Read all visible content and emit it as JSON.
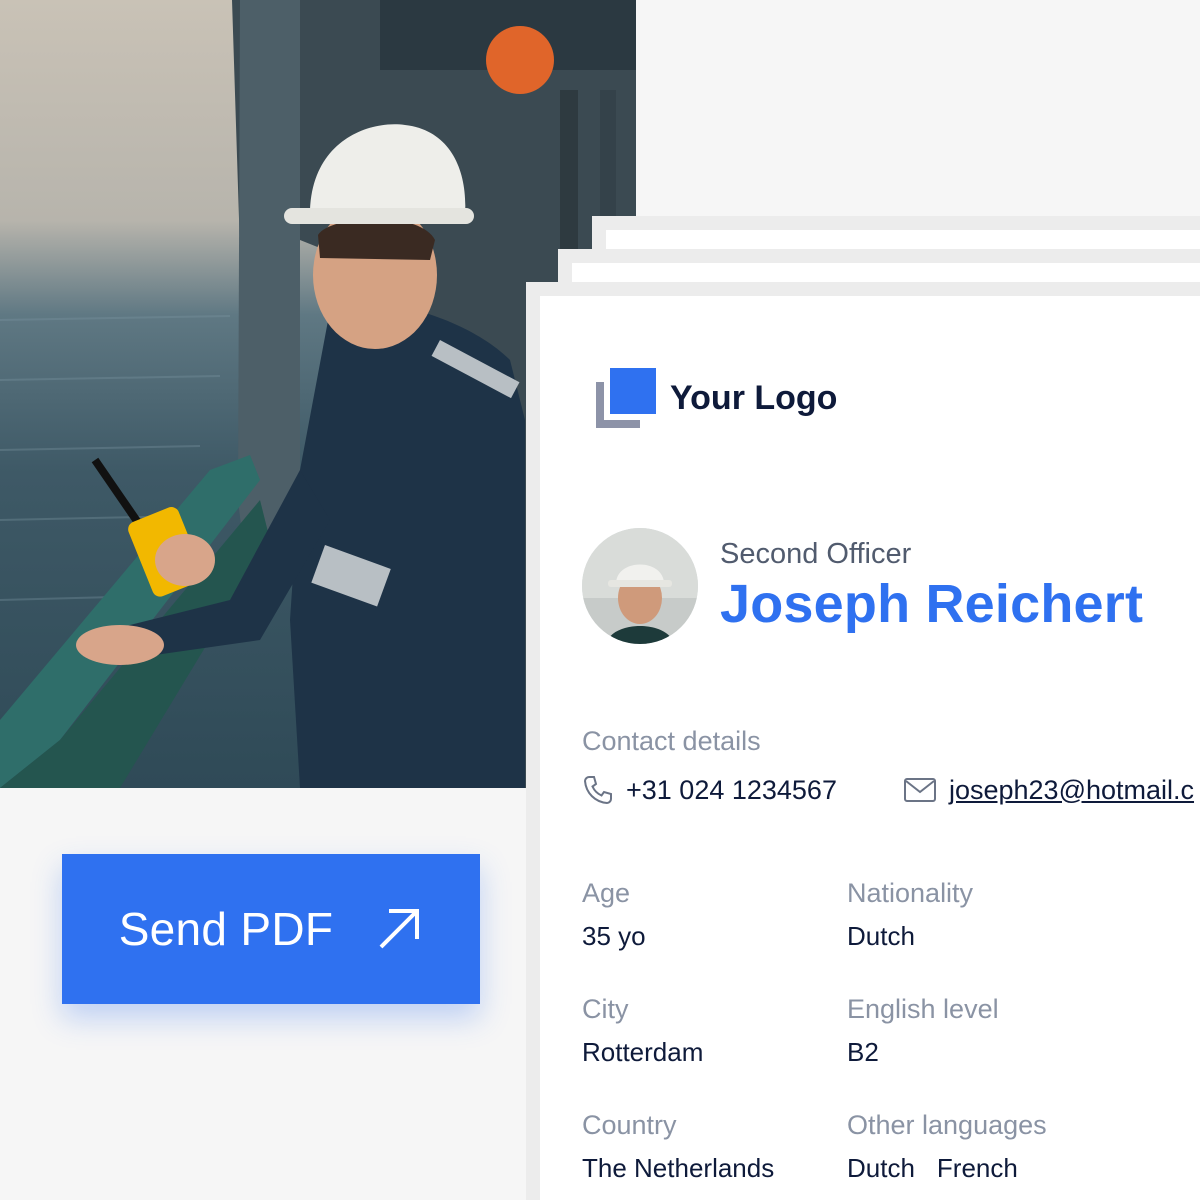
{
  "send_button": {
    "label": "Send PDF",
    "icon": "arrow-up-right-icon"
  },
  "logo": {
    "text": "Your Logo"
  },
  "profile": {
    "role": "Second Officer",
    "name": "Joseph Reichert"
  },
  "contact": {
    "title": "Contact details",
    "phone": "+31 024 1234567",
    "email": "joseph23@hotmail.c"
  },
  "fields": {
    "age": {
      "label": "Age",
      "value": "35 yo"
    },
    "nationality": {
      "label": "Nationality",
      "value": "Dutch"
    },
    "city": {
      "label": "City",
      "value": "Rotterdam"
    },
    "english": {
      "label": "English level",
      "value": "B2"
    },
    "country": {
      "label": "Country",
      "value": "The Netherlands"
    },
    "languages": {
      "label": "Other languages",
      "values": [
        "Dutch",
        "French"
      ]
    }
  },
  "colors": {
    "accent": "#2f71f0",
    "text_dark": "#0e1a3a",
    "text_muted": "#8a93a4",
    "page_bg": "#f6f6f6"
  }
}
